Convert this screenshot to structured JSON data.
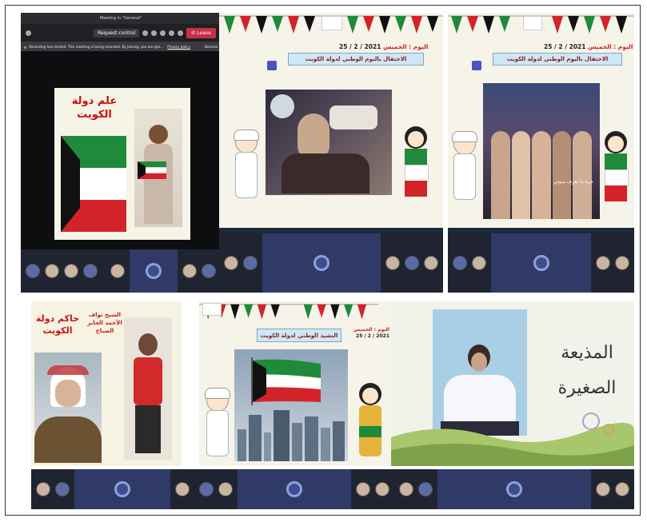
{
  "panels": {
    "p1": {
      "meeting_title": "Meeting in \"General\"",
      "request_control": "Request control",
      "leave": "Leave",
      "recording_banner": "Recording has started. This meeting is being recorded. By joining, you are giving consent for this meeting to be recorded.",
      "privacy_policy": "Privacy policy",
      "dismiss": "Dismiss",
      "slide_heading": "علم دولة الكويت"
    },
    "p2": {
      "date_label": "اليوم : الخميس",
      "date_value": "25 / 2 / 2021",
      "title": "الاحتفال باليوم الوطني لدولة الكويت"
    },
    "p3": {
      "date_label": "اليوم : الخميس",
      "date_value": "25 / 2 / 2021",
      "title": "الاحتفال باليوم الوطني لدولة الكويت",
      "video_caption": "حرة ما يعرف صوتي"
    },
    "p4": {
      "ruler_heading": "حاكم دولة الكويت",
      "ruler_name": "الشيخ نواف الأحمد الجابر الصباح"
    },
    "p5": {
      "date_label": "اليوم : الخميس",
      "date_value": "25 / 2 / 2021",
      "title": "النشيد الوطني لدولة الكويت"
    },
    "p6": {
      "caption_line1": "المذيعة",
      "caption_line2": "الصغيرة"
    }
  },
  "colors": {
    "kuwait_green": "#1f8a3a",
    "kuwait_red": "#d3232a",
    "kuwait_black": "#111111",
    "kuwait_white": "#ffffff",
    "teams_dark": "#201f22",
    "leave_red": "#c4314b",
    "heading_red": "#cc1111"
  }
}
